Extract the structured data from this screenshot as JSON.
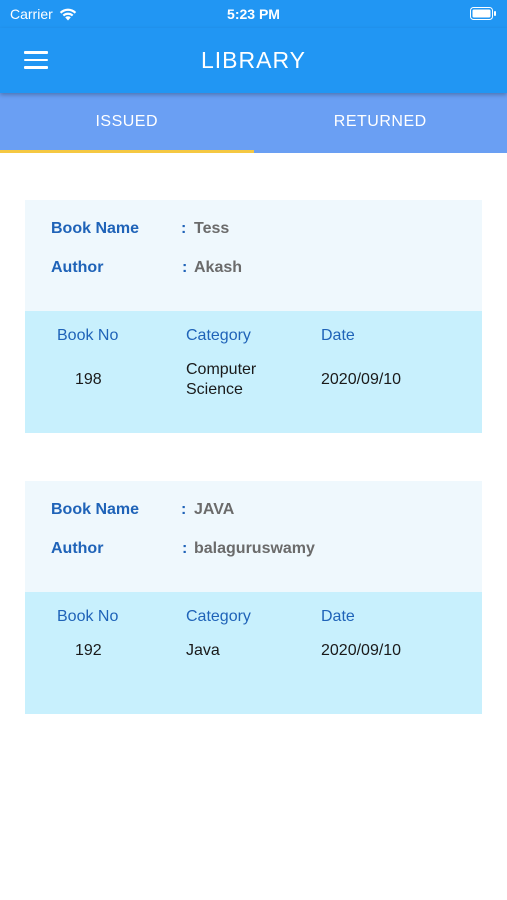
{
  "status_bar": {
    "carrier": "Carrier",
    "time": "5:23 PM"
  },
  "app_bar": {
    "title": "LIBRARY"
  },
  "tabs": [
    {
      "label": "ISSUED",
      "active": true
    },
    {
      "label": "RETURNED",
      "active": false
    }
  ],
  "labels": {
    "book_name": "Book Name",
    "author": "Author",
    "colon": ":",
    "book_no": "Book No",
    "category": "Category",
    "date": "Date"
  },
  "books": [
    {
      "name": "Tess",
      "author": "Akash",
      "book_no": "198",
      "category": "Computer Science",
      "date": "2020/09/10"
    },
    {
      "name": "JAVA",
      "author": "balaguruswamy",
      "book_no": "192",
      "category": "Java",
      "date": "2020/09/10"
    }
  ],
  "colors": {
    "app_bar": "#2196f3",
    "tab_bar": "#6a9ff3",
    "tab_indicator": "#f5c842",
    "label": "#1f63b8"
  }
}
